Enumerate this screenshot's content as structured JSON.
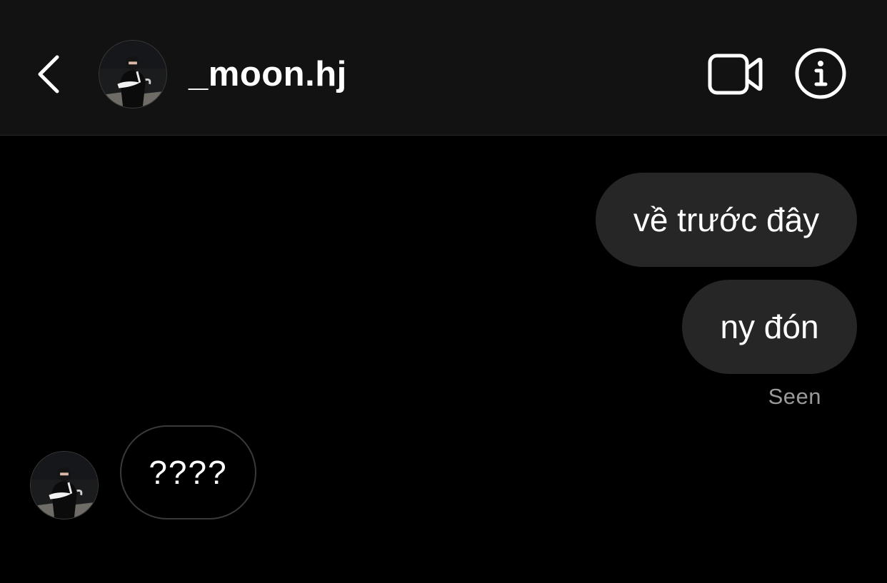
{
  "header": {
    "back_icon": "chevron-left-icon",
    "username": "_moon.hj",
    "video_icon": "video-camera-icon",
    "info_icon": "info-icon"
  },
  "messages": [
    {
      "direction": "outgoing",
      "text": "về trước đây"
    },
    {
      "direction": "outgoing",
      "text": "ny đón"
    },
    {
      "direction": "incoming",
      "text": "????"
    }
  ],
  "status": {
    "seen_label": "Seen"
  },
  "colors": {
    "header_bg": "#121212",
    "page_bg": "#000000",
    "outgoing_bubble": "#262626",
    "incoming_bubble_border": "#3a3a3a",
    "seen_text": "#9a9a9a"
  }
}
